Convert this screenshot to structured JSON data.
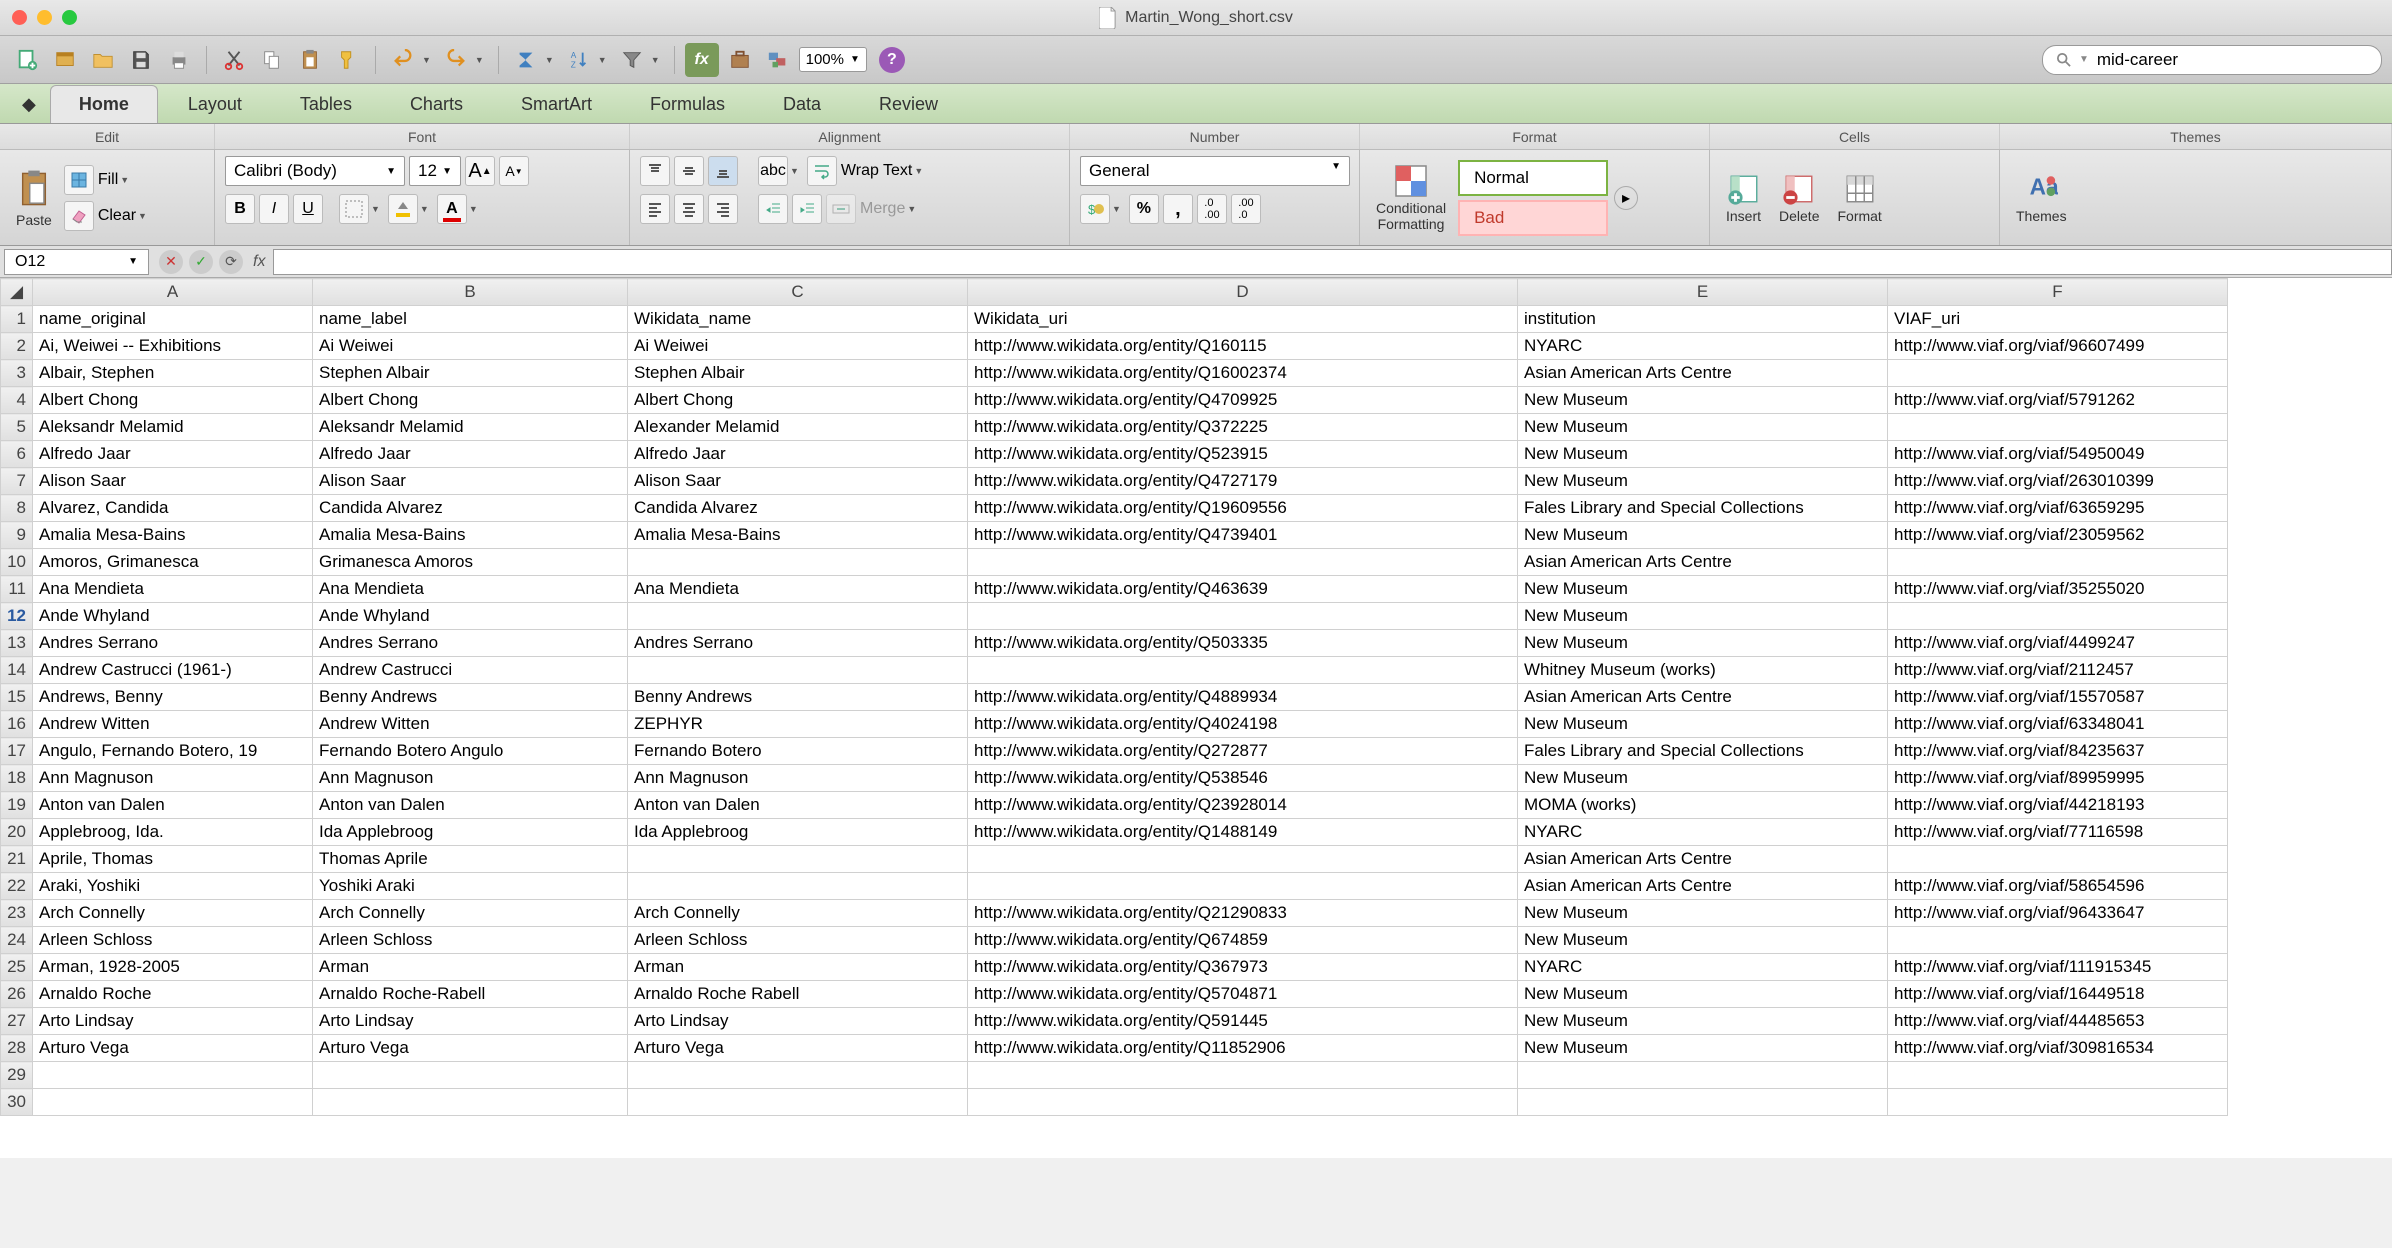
{
  "window": {
    "title": "Martin_Wong_short.csv"
  },
  "toolbar": {
    "zoom": "100%",
    "search_value": "mid-career"
  },
  "ribbon": {
    "tabs": [
      "Home",
      "Layout",
      "Tables",
      "Charts",
      "SmartArt",
      "Formulas",
      "Data",
      "Review"
    ],
    "active_tab": "Home",
    "groups": [
      "Edit",
      "Font",
      "Alignment",
      "Number",
      "Format",
      "Cells",
      "Themes"
    ],
    "edit": {
      "paste": "Paste",
      "fill": "Fill",
      "clear": "Clear"
    },
    "font": {
      "name": "Calibri (Body)",
      "size": "12",
      "bold": "B",
      "italic": "I",
      "underline": "U"
    },
    "alignment": {
      "wrap": "Wrap Text",
      "merge": "Merge"
    },
    "number": {
      "format": "General"
    },
    "format": {
      "conditional": "Conditional\nFormatting",
      "style_normal": "Normal",
      "style_bad": "Bad"
    },
    "cells": {
      "insert": "Insert",
      "delete": "Delete",
      "format": "Format"
    },
    "themes": {
      "themes": "Themes"
    }
  },
  "namebox": {
    "ref": "O12",
    "fx": "fx"
  },
  "columns": [
    "A",
    "B",
    "C",
    "D",
    "E",
    "F"
  ],
  "chart_data": {
    "type": "table",
    "headers": [
      "name_original",
      "name_label",
      "Wikidata_name",
      "Wikidata_uri",
      "institution",
      "VIAF_uri"
    ],
    "rows": [
      [
        "Ai, Weiwei -- Exhibitions",
        "Ai Weiwei",
        "Ai Weiwei",
        "http://www.wikidata.org/entity/Q160115",
        "NYARC",
        "http://www.viaf.org/viaf/96607499"
      ],
      [
        "Albair, Stephen",
        "Stephen Albair",
        "Stephen Albair",
        "http://www.wikidata.org/entity/Q16002374",
        "Asian American Arts Centre",
        ""
      ],
      [
        "Albert Chong",
        "Albert Chong",
        "Albert Chong",
        "http://www.wikidata.org/entity/Q4709925",
        "New Museum",
        "http://www.viaf.org/viaf/5791262"
      ],
      [
        "Aleksandr Melamid",
        "Aleksandr Melamid",
        "Alexander Melamid",
        "http://www.wikidata.org/entity/Q372225",
        "New Museum",
        ""
      ],
      [
        "Alfredo Jaar",
        "Alfredo Jaar",
        "Alfredo Jaar",
        "http://www.wikidata.org/entity/Q523915",
        "New Museum",
        "http://www.viaf.org/viaf/54950049"
      ],
      [
        "Alison Saar",
        "Alison Saar",
        "Alison Saar",
        "http://www.wikidata.org/entity/Q4727179",
        "New Museum",
        "http://www.viaf.org/viaf/263010399"
      ],
      [
        "Alvarez, Candida",
        "Candida Alvarez",
        "Candida Alvarez",
        "http://www.wikidata.org/entity/Q19609556",
        "Fales Library and Special Collections",
        "http://www.viaf.org/viaf/63659295"
      ],
      [
        "Amalia Mesa-Bains",
        "Amalia Mesa-Bains",
        "Amalia Mesa-Bains",
        "http://www.wikidata.org/entity/Q4739401",
        "New Museum",
        "http://www.viaf.org/viaf/23059562"
      ],
      [
        "Amoros, Grimanesca",
        "Grimanesca Amoros",
        "",
        "",
        "Asian American Arts Centre",
        ""
      ],
      [
        "Ana Mendieta",
        "Ana Mendieta",
        "Ana Mendieta",
        "http://www.wikidata.org/entity/Q463639",
        "New Museum",
        "http://www.viaf.org/viaf/35255020"
      ],
      [
        "Ande Whyland",
        "Ande Whyland",
        "",
        "",
        "New Museum",
        ""
      ],
      [
        "Andres Serrano",
        "Andres Serrano",
        "Andres Serrano",
        "http://www.wikidata.org/entity/Q503335",
        "New Museum",
        "http://www.viaf.org/viaf/4499247"
      ],
      [
        "Andrew Castrucci (1961-)",
        "Andrew Castrucci",
        "",
        "",
        "Whitney Museum (works)",
        "http://www.viaf.org/viaf/2112457"
      ],
      [
        "Andrews, Benny",
        "Benny Andrews",
        "Benny Andrews",
        "http://www.wikidata.org/entity/Q4889934",
        "Asian American Arts Centre",
        "http://www.viaf.org/viaf/15570587"
      ],
      [
        "Andrew Witten",
        "Andrew Witten",
        "ZEPHYR",
        "http://www.wikidata.org/entity/Q4024198",
        "New Museum",
        "http://www.viaf.org/viaf/63348041"
      ],
      [
        "Angulo, Fernando Botero, 19",
        "Fernando Botero Angulo",
        "Fernando Botero",
        "http://www.wikidata.org/entity/Q272877",
        "Fales Library and Special Collections",
        "http://www.viaf.org/viaf/84235637"
      ],
      [
        "Ann Magnuson",
        "Ann Magnuson",
        "Ann Magnuson",
        "http://www.wikidata.org/entity/Q538546",
        "New Museum",
        "http://www.viaf.org/viaf/89959995"
      ],
      [
        "Anton van Dalen",
        "Anton van Dalen",
        "Anton van Dalen",
        "http://www.wikidata.org/entity/Q23928014",
        "MOMA (works)",
        "http://www.viaf.org/viaf/44218193"
      ],
      [
        "Applebroog, Ida.",
        "Ida Applebroog",
        "Ida Applebroog",
        "http://www.wikidata.org/entity/Q1488149",
        "NYARC",
        "http://www.viaf.org/viaf/77116598"
      ],
      [
        "Aprile, Thomas",
        "Thomas Aprile",
        "",
        "",
        "Asian American Arts Centre",
        ""
      ],
      [
        "Araki, Yoshiki",
        "Yoshiki Araki",
        "",
        "",
        "Asian American Arts Centre",
        "http://www.viaf.org/viaf/58654596"
      ],
      [
        "Arch Connelly",
        "Arch Connelly",
        "Arch Connelly",
        "http://www.wikidata.org/entity/Q21290833",
        "New Museum",
        "http://www.viaf.org/viaf/96433647"
      ],
      [
        "Arleen Schloss",
        "Arleen Schloss",
        "Arleen Schloss",
        "http://www.wikidata.org/entity/Q674859",
        "New Museum",
        ""
      ],
      [
        "Arman, 1928-2005",
        "Arman",
        "Arman",
        "http://www.wikidata.org/entity/Q367973",
        "NYARC",
        "http://www.viaf.org/viaf/111915345"
      ],
      [
        "Arnaldo Roche",
        "Arnaldo Roche-Rabell",
        "Arnaldo Roche Rabell",
        "http://www.wikidata.org/entity/Q5704871",
        "New Museum",
        "http://www.viaf.org/viaf/16449518"
      ],
      [
        "Arto Lindsay",
        "Arto Lindsay",
        "Arto Lindsay",
        "http://www.wikidata.org/entity/Q591445",
        "New Museum",
        "http://www.viaf.org/viaf/44485653"
      ],
      [
        "Arturo Vega",
        "Arturo Vega",
        "Arturo Vega",
        "http://www.wikidata.org/entity/Q11852906",
        "New Museum",
        "http://www.viaf.org/viaf/309816534"
      ]
    ]
  },
  "selected_cell": {
    "row": 12,
    "col": "O"
  }
}
